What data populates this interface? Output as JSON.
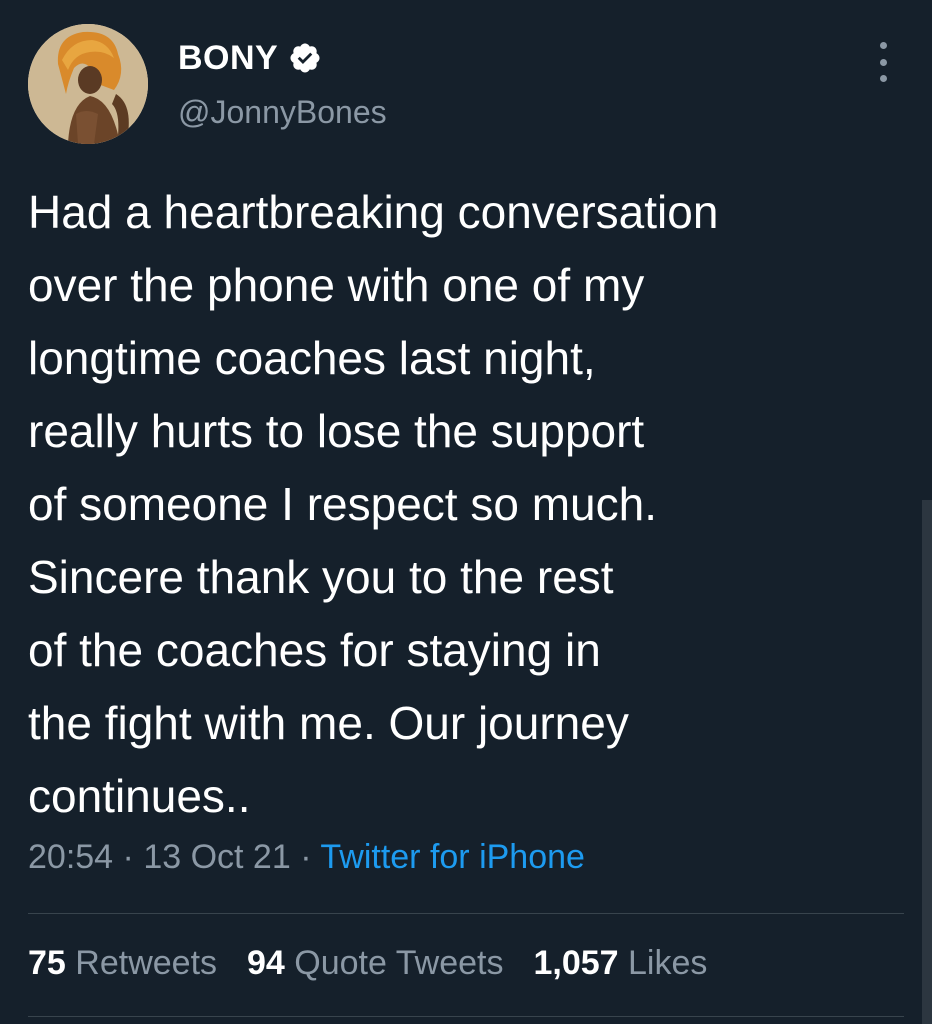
{
  "user": {
    "display_name": "BONY",
    "handle": "@JonnyBones",
    "verified_icon": "verified-badge-icon"
  },
  "tweet": {
    "lines": [
      "Had a heartbreaking conversation",
      "over the phone with one of my",
      "longtime coaches last night,",
      "really hurts to lose the support",
      "of someone I respect so much.",
      "Sincere thank you to the rest",
      "of the coaches for staying in",
      "the fight with me. Our journey",
      "continues.."
    ],
    "time": "20:54",
    "date": "13 Oct 21",
    "source": "Twitter for iPhone",
    "separator": "·"
  },
  "stats": {
    "retweets_count": "75",
    "retweets_label": "Retweets",
    "quotes_count": "94",
    "quotes_label": "Quote Tweets",
    "likes_count": "1,057",
    "likes_label": "Likes"
  },
  "colors": {
    "background": "#15202b",
    "text_primary": "#ffffff",
    "text_secondary": "#8b98a5",
    "link": "#1d9bf0",
    "divider": "#38444d"
  }
}
